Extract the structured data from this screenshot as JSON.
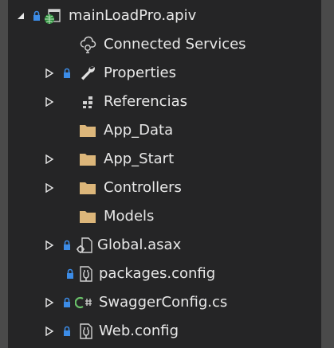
{
  "tree": {
    "items": [
      {
        "label": "mainLoadPro.apiv",
        "icon": "web-project-icon",
        "expand": "expanded",
        "lock": true
      },
      {
        "label": "Connected Services",
        "icon": "connected-services-icon",
        "expand": "none",
        "lock": false
      },
      {
        "label": "Properties",
        "icon": "wrench-icon",
        "expand": "collapsed",
        "lock": true
      },
      {
        "label": "Referencias",
        "icon": "references-icon",
        "expand": "collapsed",
        "lock": false
      },
      {
        "label": "App_Data",
        "icon": "folder-icon",
        "expand": "none",
        "lock": false
      },
      {
        "label": "App_Start",
        "icon": "folder-icon",
        "expand": "collapsed",
        "lock": false
      },
      {
        "label": "Controllers",
        "icon": "folder-icon",
        "expand": "collapsed",
        "lock": false
      },
      {
        "label": "Models",
        "icon": "folder-icon",
        "expand": "none",
        "lock": false
      },
      {
        "label": "Global.asax",
        "icon": "asax-file-icon",
        "expand": "collapsed",
        "lock": true
      },
      {
        "label": "packages.config",
        "icon": "config-file-icon",
        "expand": "none",
        "lock": true
      },
      {
        "label": "SwaggerConfig.cs",
        "icon": "csharp-file-icon",
        "expand": "collapsed",
        "lock": true
      },
      {
        "label": "Web.config",
        "icon": "config-file-icon",
        "expand": "collapsed",
        "lock": true
      }
    ]
  },
  "colors": {
    "background": "#252526",
    "text": "#e8e8e8",
    "lock": "#3c8ce7",
    "folder": "#dcb67a",
    "csharp": "#6ac26a"
  }
}
